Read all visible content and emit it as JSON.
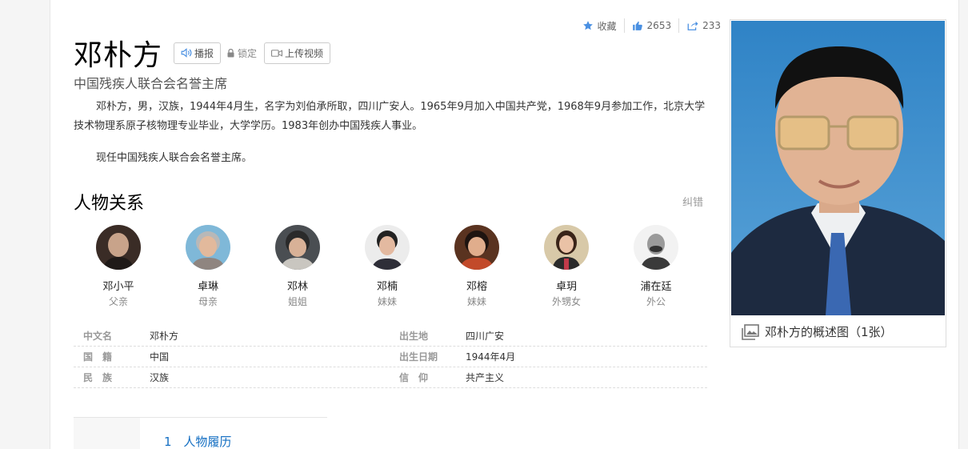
{
  "header": {
    "title": "邓朴方",
    "play_label": "播报",
    "lock_label": "锁定",
    "upload_label": "上传视频",
    "favorite_label": "收藏",
    "like_count": "2653",
    "share_count": "233"
  },
  "subtitle": "中国残疾人联合会名誉主席",
  "summary": [
    "邓朴方，男，汉族，1944年4月生，名字为刘伯承所取，四川广安人。1965年9月加入中国共产党，1968年9月参加工作，北京大学技术物理系原子核物理专业毕业，大学学历。1983年创办中国残疾人事业。",
    "现任中国残疾人联合会名誉主席。"
  ],
  "relations": {
    "title": "人物关系",
    "fix_label": "纠错",
    "people": [
      {
        "name": "邓小平",
        "relation": "父亲"
      },
      {
        "name": "卓琳",
        "relation": "母亲"
      },
      {
        "name": "邓林",
        "relation": "姐姐"
      },
      {
        "name": "邓楠",
        "relation": "妹妹"
      },
      {
        "name": "邓榕",
        "relation": "妹妹"
      },
      {
        "name": "卓玥",
        "relation": "外甥女"
      },
      {
        "name": "浦在廷",
        "relation": "外公"
      }
    ]
  },
  "basic_info": [
    {
      "k1": "中文名",
      "v1": "邓朴方",
      "k2": "出生地",
      "v2": "四川广安"
    },
    {
      "k1": "国　籍",
      "v1": "中国",
      "k2": "出生日期",
      "v2": "1944年4月"
    },
    {
      "k1": "民　族",
      "v1": "汉族",
      "k2": "信　仰",
      "v2": "共产主义"
    }
  ],
  "toc": {
    "item_num": "1",
    "item_label": "人物履历"
  },
  "photo": {
    "caption": "邓朴方的概述图（1张）"
  },
  "colors": {
    "link": "#136ec2",
    "icon_blue": "#4a90e2"
  }
}
